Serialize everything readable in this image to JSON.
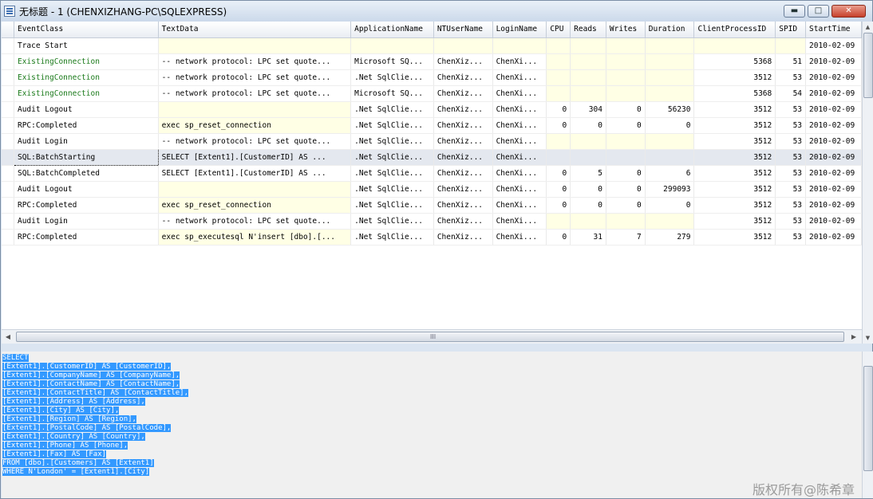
{
  "window": {
    "title": "无标题 - 1 (CHENXIZHANG-PC\\SQLEXPRESS)",
    "min_label": "▬",
    "max_label": "□",
    "close_label": "✕"
  },
  "columns": [
    "",
    "EventClass",
    "TextData",
    "ApplicationName",
    "NTUserName",
    "LoginName",
    "CPU",
    "Reads",
    "Writes",
    "Duration",
    "ClientProcessID",
    "SPID",
    "StartTime"
  ],
  "rows": [
    {
      "event": "Trace Start",
      "text": "",
      "app": "",
      "nt": "",
      "login": "",
      "cpu": "",
      "reads": "",
      "writes": "",
      "duration": "",
      "cpid": "",
      "spid": "",
      "start": "2010-02-09"
    },
    {
      "event": "ExistingConnection",
      "text": "-- network protocol: LPC  set quote...",
      "app": "Microsoft SQ...",
      "nt": "ChenXiz...",
      "login": "ChenXi...",
      "cpu": "",
      "reads": "",
      "writes": "",
      "duration": "",
      "cpid": "5368",
      "spid": "51",
      "start": "2010-02-09"
    },
    {
      "event": "ExistingConnection",
      "text": "-- network protocol: LPC  set quote...",
      ".app": "",
      "app": ".Net SqlClie...",
      "nt": "ChenXiz...",
      "login": "ChenXi...",
      "cpu": "",
      "reads": "",
      "writes": "",
      "duration": "",
      "cpid": "3512",
      "spid": "53",
      "start": "2010-02-09"
    },
    {
      "event": "ExistingConnection",
      "text": "-- network protocol: LPC  set quote...",
      "app": "Microsoft SQ...",
      "nt": "ChenXiz...",
      "login": "ChenXi...",
      "cpu": "",
      "reads": "",
      "writes": "",
      "duration": "",
      "cpid": "5368",
      "spid": "54",
      "start": "2010-02-09"
    },
    {
      "event": "Audit Logout",
      "text": "",
      "app": ".Net SqlClie...",
      "nt": "ChenXiz...",
      "login": "ChenXi...",
      "cpu": "0",
      "reads": "304",
      "writes": "0",
      "duration": "56230",
      "cpid": "3512",
      "spid": "53",
      "start": "2010-02-09"
    },
    {
      "event": "RPC:Completed",
      "text": "exec sp_reset_connection",
      "app": ".Net SqlClie...",
      "nt": "ChenXiz...",
      "login": "ChenXi...",
      "cpu": "0",
      "reads": "0",
      "writes": "0",
      "duration": "0",
      "cpid": "3512",
      "spid": "53",
      "start": "2010-02-09"
    },
    {
      "event": "Audit Login",
      "text": "-- network protocol: LPC  set quote...",
      "app": ".Net SqlClie...",
      "nt": "ChenXiz...",
      "login": "ChenXi...",
      "cpu": "",
      "reads": "",
      "writes": "",
      "duration": "",
      "cpid": "3512",
      "spid": "53",
      "start": "2010-02-09"
    },
    {
      "event": "SQL:BatchStarting",
      "text": "SELECT   [Extent1].[CustomerID] AS ...",
      "app": ".Net SqlClie...",
      "nt": "ChenXiz...",
      "login": "ChenXi...",
      "cpu": "",
      "reads": "",
      "writes": "",
      "duration": "",
      "cpid": "3512",
      "spid": "53",
      "start": "2010-02-09"
    },
    {
      "event": "SQL:BatchCompleted",
      "text": "SELECT   [Extent1].[CustomerID] AS ...",
      "app": ".Net SqlClie...",
      "nt": "ChenXiz...",
      "login": "ChenXi...",
      "cpu": "0",
      "reads": "5",
      "writes": "0",
      "duration": "6",
      "cpid": "3512",
      "spid": "53",
      "start": "2010-02-09"
    },
    {
      "event": "Audit Logout",
      "text": "",
      "app": ".Net SqlClie...",
      "nt": "ChenXiz...",
      "login": "ChenXi...",
      "cpu": "0",
      "reads": "0",
      "writes": "0",
      "duration": "299093",
      "cpid": "3512",
      "spid": "53",
      "start": "2010-02-09"
    },
    {
      "event": "RPC:Completed",
      "text": "exec sp_reset_connection",
      "app": ".Net SqlClie...",
      "nt": "ChenXiz...",
      "login": "ChenXi...",
      "cpu": "0",
      "reads": "0",
      "writes": "0",
      "duration": "0",
      "cpid": "3512",
      "spid": "53",
      "start": "2010-02-09"
    },
    {
      "event": "Audit Login",
      "text": "-- network protocol: LPC  set quote...",
      "app": ".Net SqlClie...",
      "nt": "ChenXiz...",
      "login": "ChenXi...",
      "cpu": "",
      "reads": "",
      "writes": "",
      "duration": "",
      "cpid": "3512",
      "spid": "53",
      "start": "2010-02-09"
    },
    {
      "event": "RPC:Completed",
      "text": "exec sp_executesql N'insert [dbo].[...",
      "app": ".Net SqlClie...",
      "nt": "ChenXiz...",
      "login": "ChenXi...",
      "cpu": "0",
      "reads": "31",
      "writes": "7",
      "duration": "279",
      "cpid": "3512",
      "spid": "53",
      "start": "2010-02-09"
    }
  ],
  "selected_row": 7,
  "sql_text": [
    "SELECT",
    "[Extent1].[CustomerID] AS [CustomerID],",
    "[Extent1].[CompanyName] AS [CompanyName],",
    "[Extent1].[ContactName] AS [ContactName],",
    "[Extent1].[ContactTitle] AS [ContactTitle],",
    "[Extent1].[Address] AS [Address],",
    "[Extent1].[City] AS [City],",
    "[Extent1].[Region] AS [Region],",
    "[Extent1].[PostalCode] AS [PostalCode],",
    "[Extent1].[Country] AS [Country],",
    "[Extent1].[Phone] AS [Phone],",
    "[Extent1].[Fax] AS [Fax]",
    "FROM [dbo].[Customers] AS [Extent1]",
    "WHERE N'London' = [Extent1].[City]"
  ],
  "scroll": {
    "grip": "III",
    "left": "◀",
    "right": "▶",
    "up": "▲",
    "down": "▼"
  },
  "watermark": "版权所有@陈希章",
  "colors": {
    "selection": "#3399ff",
    "green_event": "#1a7a1a",
    "yellow_cell": "#ffffe5"
  }
}
